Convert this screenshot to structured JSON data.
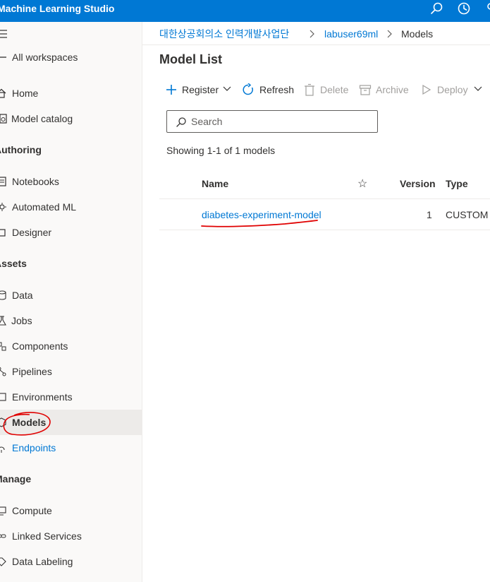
{
  "app": {
    "title": "Machine Learning Studio"
  },
  "header_icons": [
    "search-icon",
    "history-icon"
  ],
  "sidebar": {
    "top_items": [
      {
        "label": "All workspaces",
        "icon": "arrow-left-icon"
      },
      {
        "label": "Home",
        "icon": "home-icon"
      },
      {
        "label": "Model catalog",
        "icon": "catalog-icon"
      }
    ],
    "sections": [
      {
        "title": "Authoring",
        "items": [
          {
            "label": "Notebooks",
            "icon": "notebook-icon"
          },
          {
            "label": "Automated ML",
            "icon": "automl-icon"
          },
          {
            "label": "Designer",
            "icon": "designer-icon"
          }
        ]
      },
      {
        "title": "Assets",
        "items": [
          {
            "label": "Data",
            "icon": "data-icon"
          },
          {
            "label": "Jobs",
            "icon": "jobs-icon"
          },
          {
            "label": "Components",
            "icon": "components-icon"
          },
          {
            "label": "Pipelines",
            "icon": "pipelines-icon"
          },
          {
            "label": "Environments",
            "icon": "environments-icon"
          },
          {
            "label": "Models",
            "icon": "models-icon",
            "selected": true
          },
          {
            "label": "Endpoints",
            "icon": "endpoints-icon"
          }
        ]
      },
      {
        "title": "Manage",
        "items": [
          {
            "label": "Compute",
            "icon": "compute-icon"
          },
          {
            "label": "Linked Services",
            "icon": "linked-services-icon"
          },
          {
            "label": "Data Labeling",
            "icon": "data-labeling-icon"
          }
        ]
      }
    ]
  },
  "breadcrumb": [
    "대한상공회의소 인력개발사업단",
    "labuser69ml",
    "Models"
  ],
  "page_title": "Model List",
  "toolbar": {
    "register": "Register",
    "refresh": "Refresh",
    "delete": "Delete",
    "archive": "Archive",
    "deploy": "Deploy"
  },
  "search": {
    "placeholder": "Search",
    "value": ""
  },
  "showing_text": "Showing 1-1 of 1 models",
  "table": {
    "columns": [
      "Name",
      "☆",
      "Version",
      "Type"
    ],
    "rows": [
      {
        "name": "diabetes-experiment-model",
        "version": "1",
        "type": "CUSTOM"
      }
    ]
  },
  "colors": {
    "accent": "#0078d4",
    "annotation": "#e00000"
  }
}
